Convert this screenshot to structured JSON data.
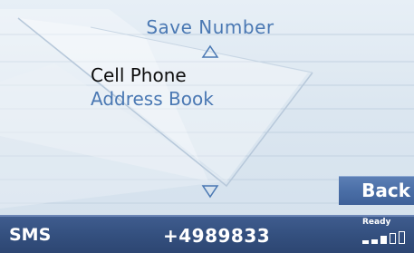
{
  "screen": {
    "title": "Save Number",
    "menu": {
      "items": [
        {
          "label": "Cell Phone",
          "selected": true
        },
        {
          "label": "Address Book",
          "selected": false
        }
      ]
    },
    "scroll": {
      "up_icon": "triangle-up-outline",
      "down_icon": "triangle-down-outline"
    },
    "back_label": "Back"
  },
  "status_bar": {
    "mode": "SMS",
    "number": "+4989833",
    "state": "Ready",
    "signal": {
      "filled_bars": 3,
      "total_bars": 5
    }
  },
  "colors": {
    "accent_text": "#4a78b3",
    "selected_text": "#0d0d0d",
    "status_bar": "#34507f",
    "back_button": "#4a6ea6"
  }
}
